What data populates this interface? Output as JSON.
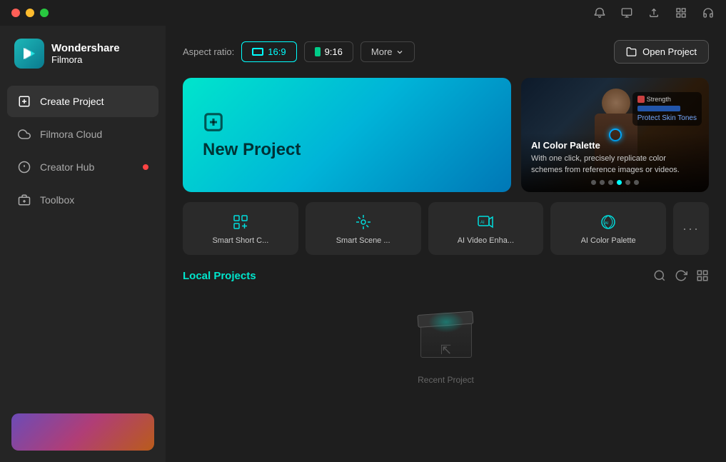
{
  "app": {
    "name": "Wondershare",
    "subname": "Filmora"
  },
  "titlebar": {
    "icons": [
      "notification",
      "account",
      "upload",
      "grid",
      "headphone"
    ]
  },
  "sidebar": {
    "items": [
      {
        "id": "create-project",
        "label": "Create Project",
        "icon": "➕",
        "active": true,
        "badge": false
      },
      {
        "id": "filmora-cloud",
        "label": "Filmora Cloud",
        "icon": "☁",
        "active": false,
        "badge": false
      },
      {
        "id": "creator-hub",
        "label": "Creator Hub",
        "icon": "💡",
        "active": false,
        "badge": true
      },
      {
        "id": "toolbox",
        "label": "Toolbox",
        "icon": "🧰",
        "active": false,
        "badge": false
      }
    ]
  },
  "aspect_ratio": {
    "label": "Aspect ratio:",
    "options": [
      {
        "id": "16-9",
        "label": "16:9",
        "active": true
      },
      {
        "id": "9-16",
        "label": "9:16",
        "active": false
      }
    ],
    "more_label": "More",
    "open_project_label": "Open Project"
  },
  "new_project": {
    "label": "New Project"
  },
  "ai_feature": {
    "title": "AI Color Palette",
    "description": "With one click, precisely replicate color schemes from reference images or videos.",
    "dots": [
      0,
      1,
      2,
      3,
      4,
      5
    ],
    "active_dot": 3
  },
  "tools": [
    {
      "id": "smart-short",
      "label": "Smart Short C...",
      "icon": "smart-short"
    },
    {
      "id": "smart-scene",
      "label": "Smart Scene ...",
      "icon": "smart-scene"
    },
    {
      "id": "ai-video",
      "label": "AI Video Enha...",
      "icon": "ai-video"
    },
    {
      "id": "ai-color",
      "label": "AI Color Palette",
      "icon": "ai-color"
    },
    {
      "id": "more-tools",
      "label": "···",
      "icon": "ellipsis"
    }
  ],
  "local_projects": {
    "title": "Local Projects",
    "empty_text": "Recent Project",
    "actions": [
      "search",
      "refresh",
      "grid-view"
    ]
  }
}
